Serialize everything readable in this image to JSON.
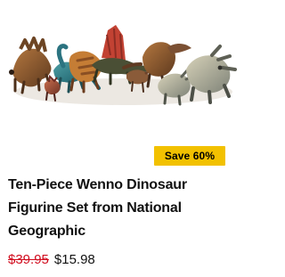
{
  "product": {
    "image_alt": "Ten dinosaur figurines",
    "badge": "Save 60%",
    "title": "Ten-Piece Wenno Dinosaur Figurine Set from National Geographic",
    "original_price": "$39.95",
    "sale_price": "$15.98"
  },
  "colors": {
    "badge_background": "#f2c100",
    "original_price": "#d10d1f",
    "text": "#111111"
  }
}
